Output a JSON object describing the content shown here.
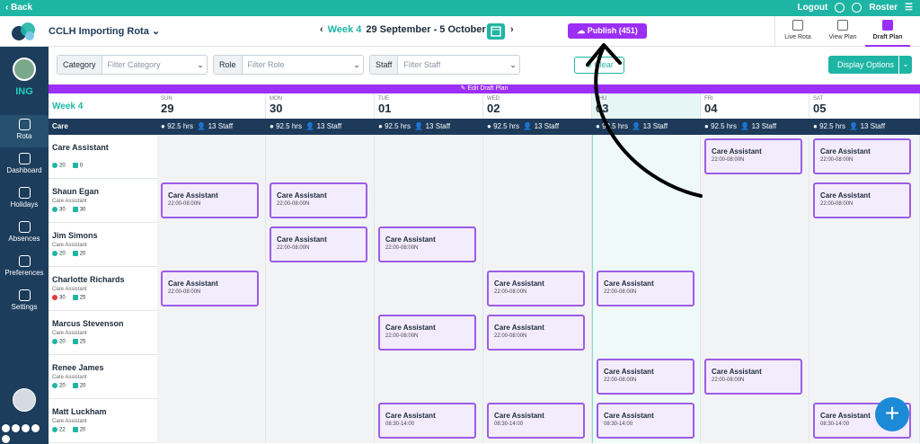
{
  "topbar": {
    "back": "‹ Back",
    "logout": "Logout",
    "roster": "Roster"
  },
  "header": {
    "rota_name": "CCLH Importing Rota",
    "week": "Week 4",
    "range": "29 September - 5 October",
    "publish": "Publish (451)"
  },
  "views": [
    {
      "label": "Live Rota"
    },
    {
      "label": "View Plan"
    },
    {
      "label": "Draft Plan"
    }
  ],
  "sidebar": {
    "org": "ING",
    "items": [
      {
        "label": "Rota"
      },
      {
        "label": "Dashboard"
      },
      {
        "label": "Holidays"
      },
      {
        "label": "Absences"
      },
      {
        "label": "Preferences"
      },
      {
        "label": "Settings"
      }
    ]
  },
  "filters": {
    "category_label": "Category",
    "category_placeholder": "Filter Category",
    "role_label": "Role",
    "role_placeholder": "Filter Role",
    "staff_label": "Staff",
    "staff_placeholder": "Filter Staff",
    "clear": "Clear",
    "display": "Display Options"
  },
  "editbar": "Edit Draft Plan",
  "grid": {
    "week_label": "Week 4",
    "group": "Care",
    "days": [
      {
        "name": "SUN",
        "date": "29"
      },
      {
        "name": "MON",
        "date": "30"
      },
      {
        "name": "TUE",
        "date": "01"
      },
      {
        "name": "WED",
        "date": "02"
      },
      {
        "name": "THU",
        "date": "03"
      },
      {
        "name": "FRI",
        "date": "04"
      },
      {
        "name": "SAT",
        "date": "05"
      }
    ],
    "stats": {
      "hrs": "92.5 hrs",
      "staff": "13 Staff"
    },
    "rows": [
      {
        "name": "Care Assistant",
        "role": "",
        "a": "20",
        "b": "0",
        "red": false,
        "shifts": [
          null,
          null,
          null,
          null,
          null,
          "22:00-08:00N",
          "22:00-08:00N"
        ]
      },
      {
        "name": "Shaun Egan",
        "role": "Care Assistant",
        "a": "30",
        "b": "30",
        "red": false,
        "shifts": [
          "22:00-08:00N",
          "22:00-08:00N",
          null,
          null,
          null,
          null,
          "22:00-08:00N"
        ]
      },
      {
        "name": "Jim Simons",
        "role": "Care Assistant",
        "a": "20",
        "b": "20",
        "red": false,
        "shifts": [
          null,
          "22:00-08:00N",
          "22:00-08:00N",
          null,
          null,
          null,
          null
        ]
      },
      {
        "name": "Charlotte Richards",
        "role": "Care Assistant",
        "a": "30",
        "b": "25",
        "red": true,
        "shifts": [
          "22:00-08:00N",
          null,
          null,
          "22:00-08:00N",
          "22:00-08:00N",
          null,
          null
        ]
      },
      {
        "name": "Marcus Stevenson",
        "role": "Care Assistant",
        "a": "20",
        "b": "25",
        "red": false,
        "shifts": [
          null,
          null,
          "22:00-08:00N",
          "22:00-08:00N",
          null,
          null,
          null
        ]
      },
      {
        "name": "Renee James",
        "role": "Care Assistant",
        "a": "20",
        "b": "20",
        "red": false,
        "shifts": [
          null,
          null,
          null,
          null,
          "22:00-08:00N",
          "22:00-08:00N",
          null
        ]
      },
      {
        "name": "Matt Luckham",
        "role": "Care Assistant",
        "a": "22",
        "b": "20",
        "red": false,
        "shifts": [
          null,
          null,
          "08:30-14:00",
          "08:30-14:00",
          "08:30-14:00",
          null,
          "08:30-14:00"
        ]
      }
    ],
    "shift_title": "Care Assistant"
  },
  "fab": "+"
}
